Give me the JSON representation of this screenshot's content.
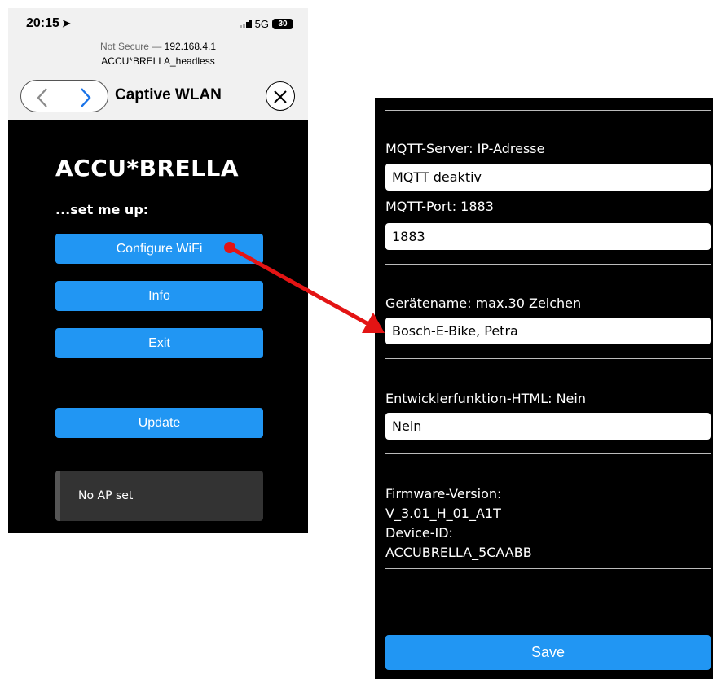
{
  "left_screen": {
    "status_bar": {
      "time": "20:15",
      "network": "5G",
      "battery": "30"
    },
    "url": {
      "security": "Not Secure",
      "separator": "—",
      "address": "192.168.4.1",
      "page_title": "ACCU*BRELLA_headless"
    },
    "nav": {
      "back_icon": "chevron-left",
      "forward_icon": "chevron-right",
      "title": "Captive WLAN",
      "close_icon": "close"
    },
    "brand": "ACCU*BRELLA",
    "subtitle": "...set me up:",
    "buttons": {
      "configure": "Configure WiFi",
      "info": "Info",
      "exit": "Exit",
      "update": "Update"
    },
    "status_message": "No AP set"
  },
  "right_screen": {
    "mqtt_server_label": "MQTT-Server: IP-Adresse",
    "mqtt_server_value": "MQTT deaktiv",
    "mqtt_port_label": "MQTT-Port: 1883",
    "mqtt_port_value": "1883",
    "device_name_label": "Gerätename: max.30 Zeichen",
    "device_name_value": "Bosch-E-Bike, Petra",
    "dev_html_label": "Entwicklerfunktion-HTML: Nein",
    "dev_html_value": "Nein",
    "firmware_label": "Firmware-Version:",
    "firmware_value": "V_3.01_H_01_A1T",
    "device_id_label": "Device-ID:",
    "device_id_value": "ACCUBRELLA_5CAABB",
    "save_label": "Save"
  },
  "colors": {
    "accent_blue": "#2196f3",
    "arrow_red": "#e31414",
    "screen_bg": "#000000",
    "ios_link_blue": "#1a73e8"
  }
}
